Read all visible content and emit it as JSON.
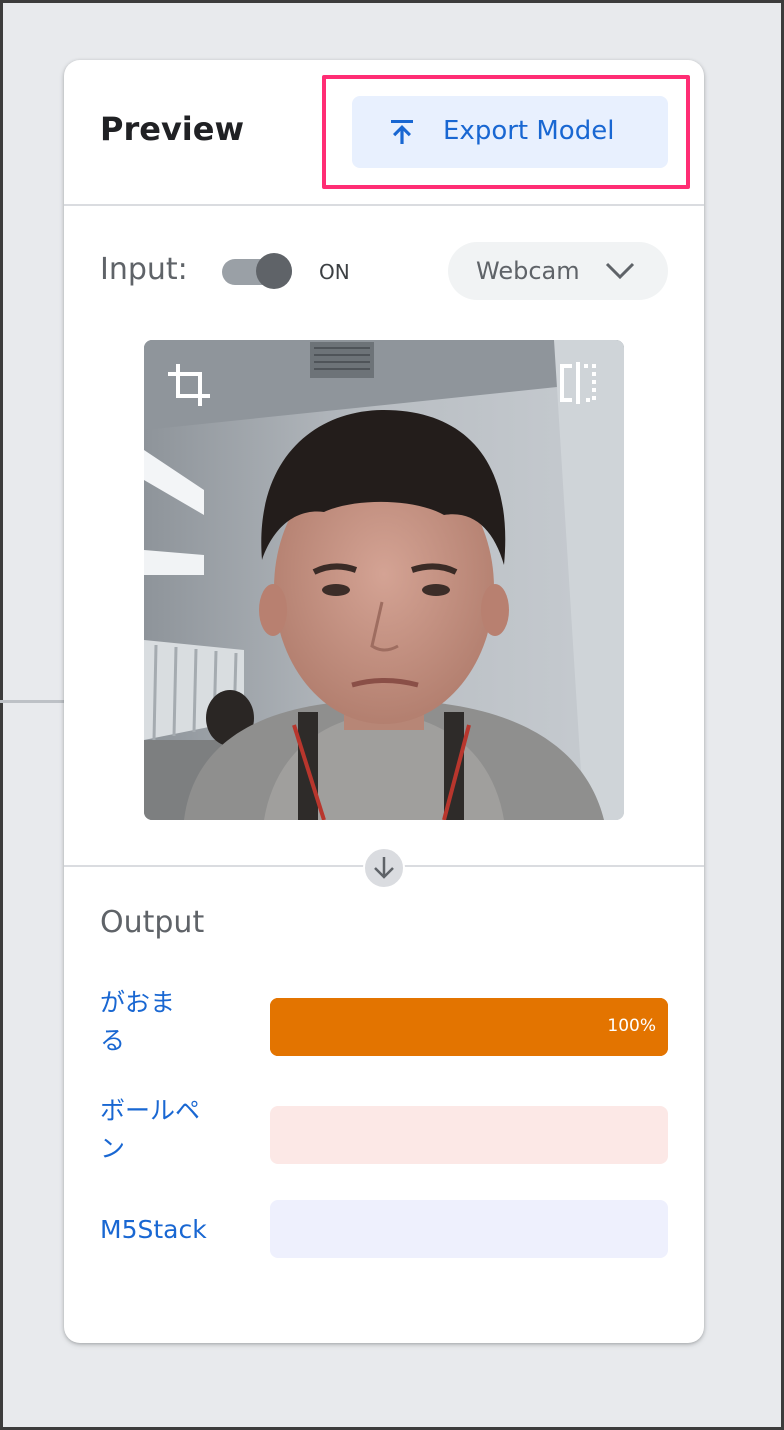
{
  "panel": {
    "title": "Preview",
    "export_label": "Export Model"
  },
  "input": {
    "label": "Input:",
    "toggle_state": "ON",
    "toggle_on": true,
    "source": "Webcam"
  },
  "output": {
    "label": "Output",
    "classes": [
      {
        "name": "がおま\nる",
        "percent_label": "100%",
        "confidence": 1.0,
        "fill_color": "#e37400",
        "track_color": "#e37400"
      },
      {
        "name": "ボールペ\nン",
        "percent_label": "",
        "confidence": 0.0,
        "fill_color": "#ff5252",
        "track_color": "#fce8e6"
      },
      {
        "name": "M5Stack",
        "percent_label": "",
        "confidence": 0.0,
        "fill_color": "#5c6bc0",
        "track_color": "#eef0fd"
      }
    ]
  },
  "icons": {
    "export": "upload-arrow-icon",
    "dropdown": "chevron-down-icon",
    "crop": "crop-icon",
    "flip": "flip-icon",
    "flow": "arrow-down-icon"
  },
  "colors": {
    "accent": "#1967d2",
    "highlight": "#ff2d74",
    "top_class": "#e37400"
  }
}
